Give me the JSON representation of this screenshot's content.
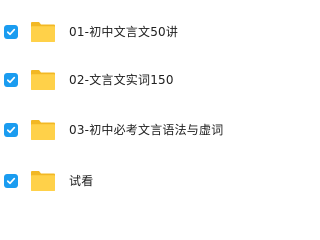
{
  "files": [
    {
      "name": "01-初中文言文50讲",
      "checked": true,
      "icon": "folder-icon"
    },
    {
      "name": "02-文言文实词150",
      "checked": true,
      "icon": "folder-icon"
    },
    {
      "name": "03-初中必考文言语法与虚词",
      "checked": true,
      "icon": "folder-icon"
    },
    {
      "name": "试看",
      "checked": true,
      "icon": "folder-icon"
    }
  ],
  "colors": {
    "checkbox": "#1a9cf0",
    "folder_back": "#f2b824",
    "folder_front": "#ffd149"
  }
}
